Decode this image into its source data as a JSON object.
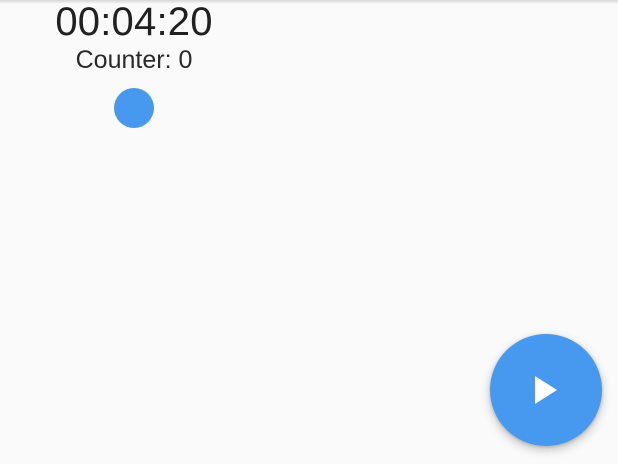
{
  "timer": {
    "elapsed": "00:04:20"
  },
  "counter": {
    "text": "Counter: 0"
  },
  "indicator": {
    "color": "#4699ee"
  },
  "fab": {
    "icon": "play-icon",
    "color": "#4699ee",
    "icon_color": "#ffffff"
  }
}
